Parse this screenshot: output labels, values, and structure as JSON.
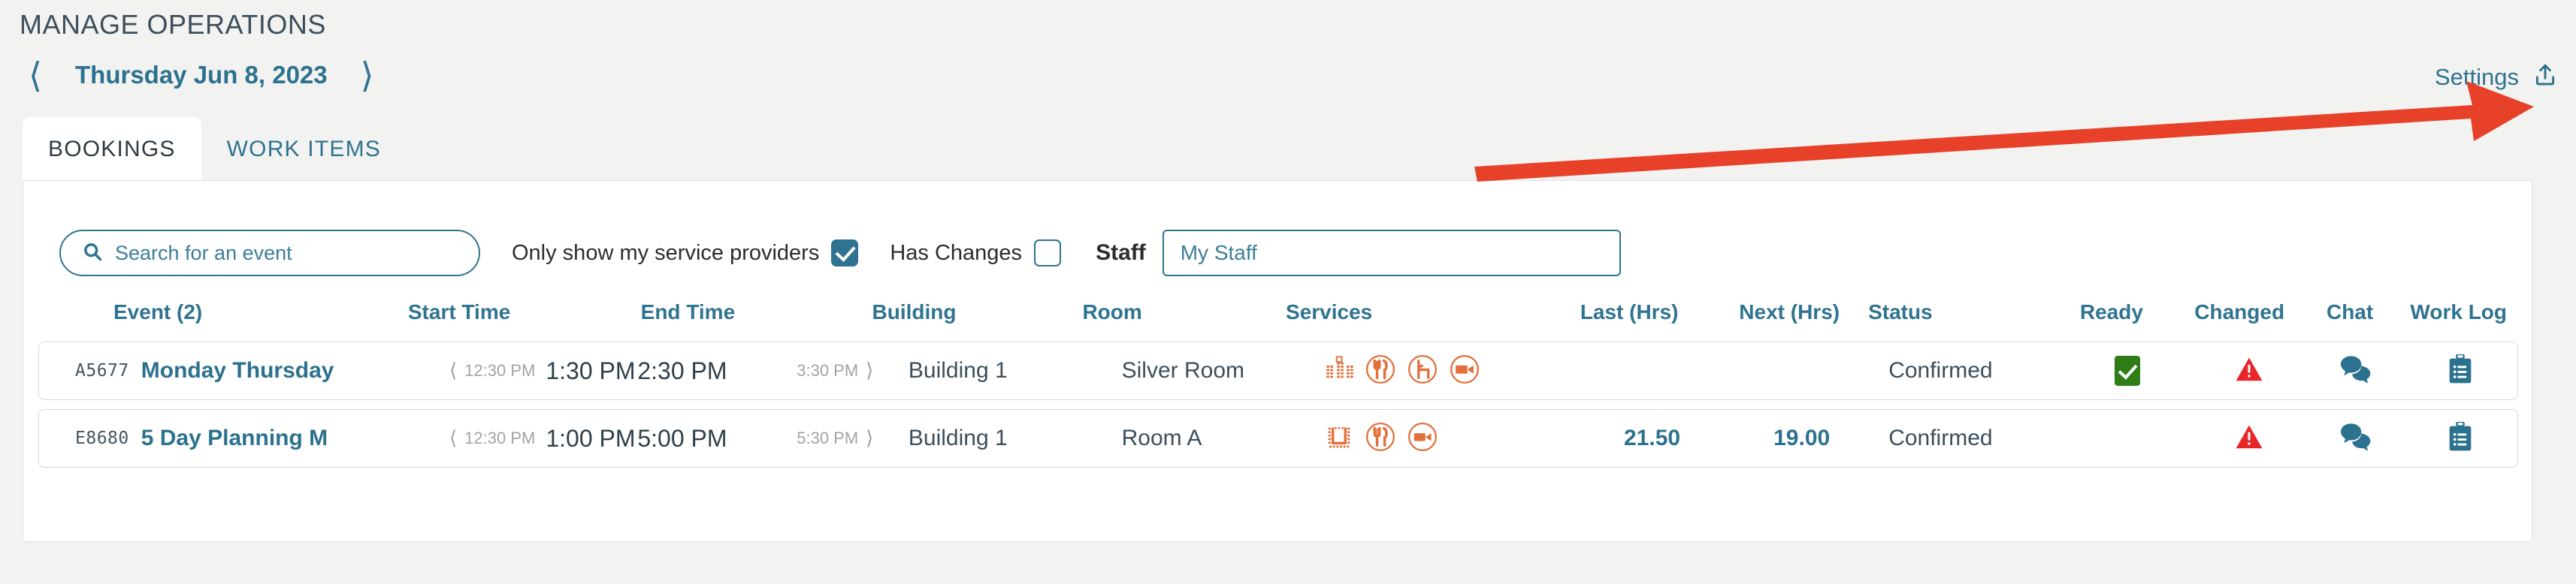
{
  "header": {
    "title": "MANAGE OPERATIONS",
    "prev_icon": "chevron-left-icon",
    "next_icon": "chevron-right-icon",
    "date": "Thursday Jun 8, 2023",
    "settings_label": "Settings",
    "export_icon": "upload-share-icon"
  },
  "tabs": [
    {
      "label": "BOOKINGS",
      "active": true
    },
    {
      "label": "WORK ITEMS",
      "active": false
    }
  ],
  "filters": {
    "search_placeholder": "Search for an event",
    "search_value": "",
    "search_icon": "search-icon",
    "only_my_providers_label": "Only show my service providers",
    "only_my_providers_checked": true,
    "has_changes_label": "Has Changes",
    "has_changes_checked": false,
    "staff_label": "Staff",
    "staff_placeholder": "My Staff",
    "staff_value": ""
  },
  "table": {
    "columns": [
      "Event (2)",
      "Start Time",
      "End Time",
      "Building",
      "Room",
      "Services",
      "Last (Hrs)",
      "Next (Hrs)",
      "Status",
      "Ready",
      "Changed",
      "Chat",
      "Work Log"
    ],
    "rows": [
      {
        "code": "A5677",
        "name": "Monday Thursday",
        "setup_time": "12:30 PM",
        "start_time": "1:30 PM",
        "end_time": "2:30 PM",
        "teardown_time": "3:30 PM",
        "building": "Building 1",
        "room": "Silver Room",
        "services": [
          "theater-seating-icon",
          "catering-icon",
          "furniture-chair-icon",
          "av-video-icon"
        ],
        "last_hrs": "",
        "next_hrs": "",
        "status": "Confirmed",
        "ready": true,
        "changed": "warning-triangle-icon",
        "chat": "chat-bubbles-icon",
        "work_log": "clipboard-icon"
      },
      {
        "code": "E8680",
        "name": "5 Day Planning M",
        "setup_time": "12:30 PM",
        "start_time": "1:00 PM",
        "end_time": "5:00 PM",
        "teardown_time": "5:30 PM",
        "building": "Building 1",
        "room": "Room A",
        "services": [
          "u-shape-seating-icon",
          "catering-icon",
          "av-video-icon"
        ],
        "last_hrs": "21.50",
        "next_hrs": "19.00",
        "status": "Confirmed",
        "ready": false,
        "changed": "warning-triangle-icon",
        "chat": "chat-bubbles-icon",
        "work_log": "clipboard-icon"
      }
    ]
  },
  "annotation": {
    "type": "arrow",
    "color": "#e8412a",
    "points_to": "export-icon"
  },
  "colors": {
    "accent_teal": "#2f7390",
    "link_teal": "#2c728f",
    "text_dark": "#3d4e5b",
    "service_orange": "#e2703a",
    "ready_green": "#2e7d17",
    "warning_red": "#e8262a",
    "page_bg": "#f2f2f1"
  }
}
